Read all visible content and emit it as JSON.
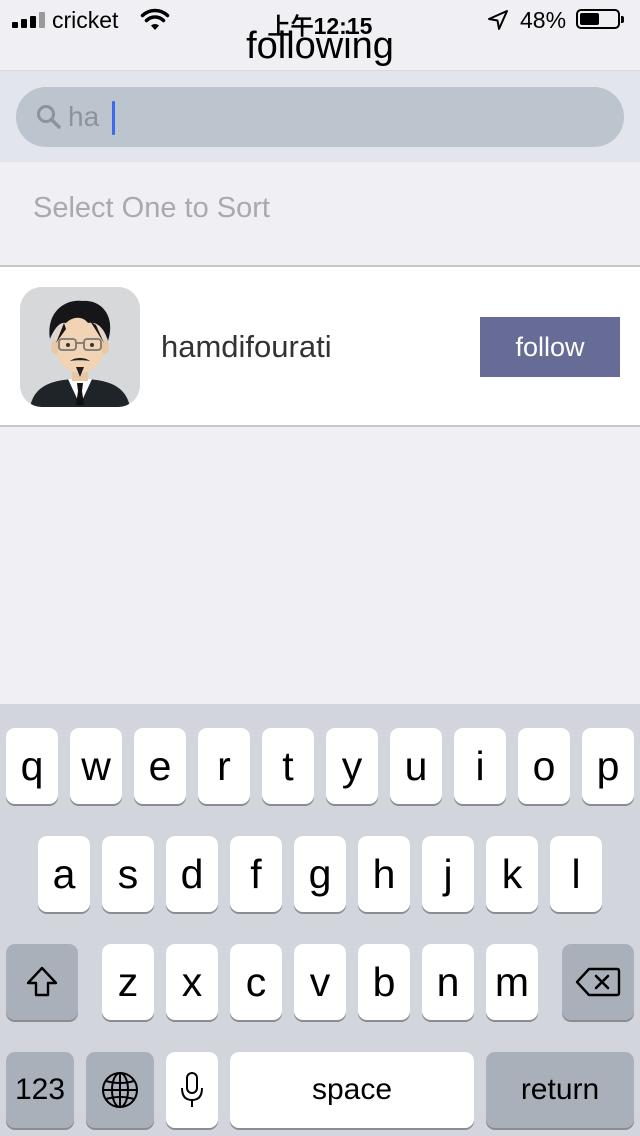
{
  "status_bar": {
    "carrier": "cricket",
    "time": "上午12:15",
    "battery_percent": "48%",
    "battery_level": 0.48
  },
  "nav": {
    "title": "following"
  },
  "search": {
    "value": "ha",
    "icon": "search-icon"
  },
  "sort": {
    "label": "Select One to Sort"
  },
  "results": [
    {
      "username": "hamdifourati",
      "button_label": "follow"
    }
  ],
  "keyboard": {
    "row1": [
      "q",
      "w",
      "e",
      "r",
      "t",
      "y",
      "u",
      "i",
      "o",
      "p"
    ],
    "row2": [
      "a",
      "s",
      "d",
      "f",
      "g",
      "h",
      "j",
      "k",
      "l"
    ],
    "row3": [
      "z",
      "x",
      "c",
      "v",
      "b",
      "n",
      "m"
    ],
    "numbers_label": "123",
    "space_label": "space",
    "return_label": "return"
  },
  "colors": {
    "follow_button": "#676c96",
    "caret": "#3b6cf0",
    "keyboard_bg": "#d2d5db"
  }
}
